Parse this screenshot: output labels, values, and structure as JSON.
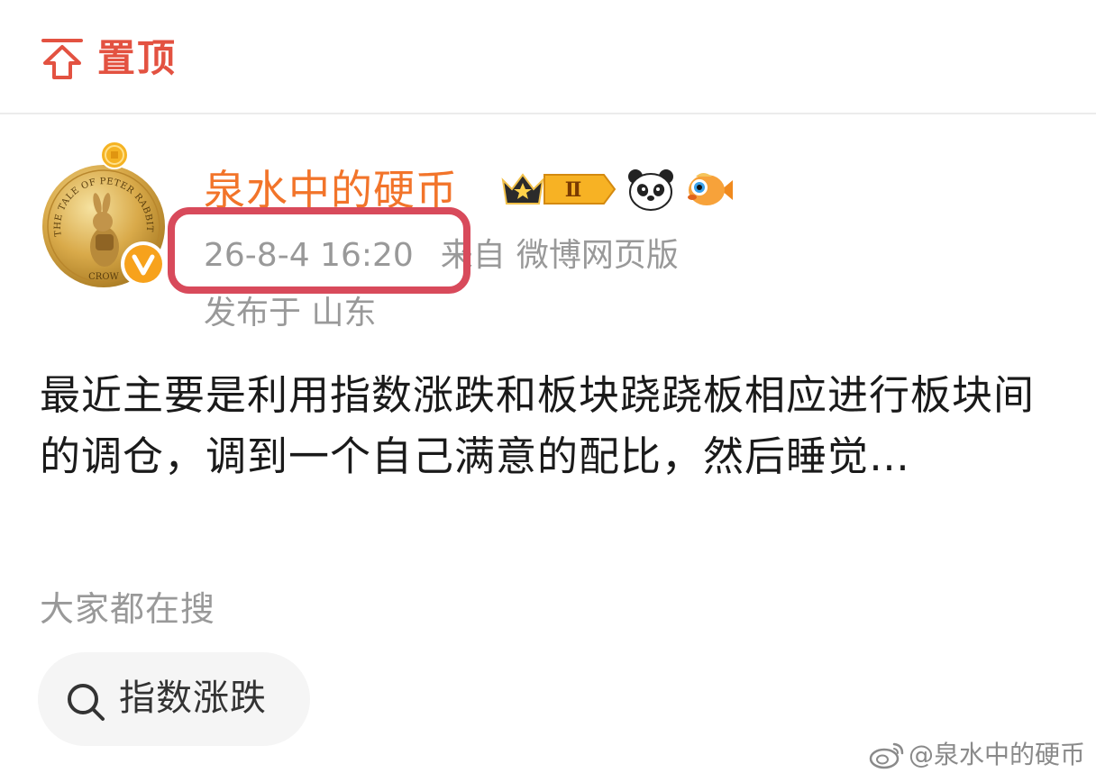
{
  "pin_bar": {
    "label": "置顶"
  },
  "author": {
    "name": "泉水中的硬币",
    "vip_level": "Ⅱ",
    "avatar_text": {
      "arc": "THE TALE OF PETER RABBIT",
      "bottom": "CROW"
    }
  },
  "meta": {
    "time": "26-8-4 16:20",
    "from_label": "来自",
    "source": "微博网页版",
    "location": "发布于 山东"
  },
  "post": {
    "text": "最近主要是利用指数涨跌和板块跷跷板相应进行板块间的调仓，调到一个自己满意的配比，然后睡觉…"
  },
  "search": {
    "heading": "大家都在搜",
    "chip_label": "指数涨跌"
  },
  "watermark": {
    "text": "@泉水中的硬币"
  },
  "colors": {
    "accent_red": "#e35241",
    "username_orange": "#f2742a",
    "highlight_box": "#d84a5b",
    "meta_gray": "#999999"
  }
}
